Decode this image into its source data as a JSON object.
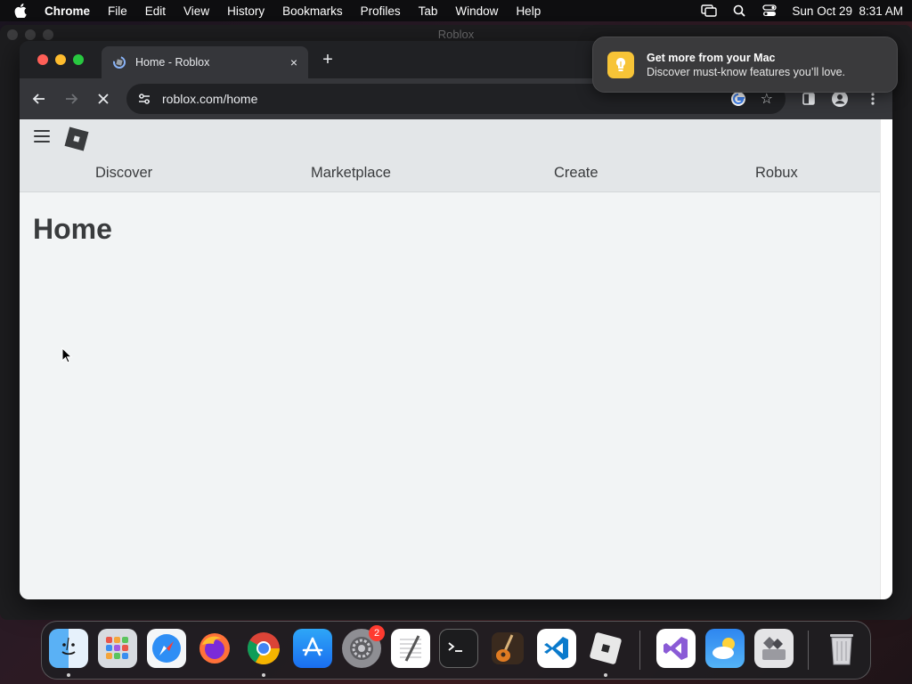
{
  "menubar": {
    "app_name": "Chrome",
    "items": [
      "File",
      "Edit",
      "View",
      "History",
      "Bookmarks",
      "Profiles",
      "Tab",
      "Window",
      "Help"
    ],
    "datetime": "Sun Oct 29  8:31 AM"
  },
  "background_window": {
    "title": "Roblox"
  },
  "browser": {
    "tab": {
      "title": "Home - Roblox",
      "close": "×"
    },
    "new_tab": "+",
    "url": "roblox.com/home",
    "star": "☆"
  },
  "page": {
    "nav": [
      "Discover",
      "Marketplace",
      "Create",
      "Robux"
    ],
    "title": "Home"
  },
  "notification": {
    "title": "Get more from your Mac",
    "body": "Discover must-know features you’ll love.",
    "icon": "lightbulb-icon"
  },
  "dock": {
    "apps": [
      "Finder",
      "Launchpad",
      "Safari",
      "Firefox",
      "Chrome",
      "App Store",
      "System Settings",
      "TextEdit",
      "Terminal",
      "GarageBand",
      "Visual Studio Code",
      "Roblox",
      "Visual Studio",
      "Weather",
      "Boot Camp Assistant",
      "Trash"
    ],
    "settings_badge": "2"
  }
}
